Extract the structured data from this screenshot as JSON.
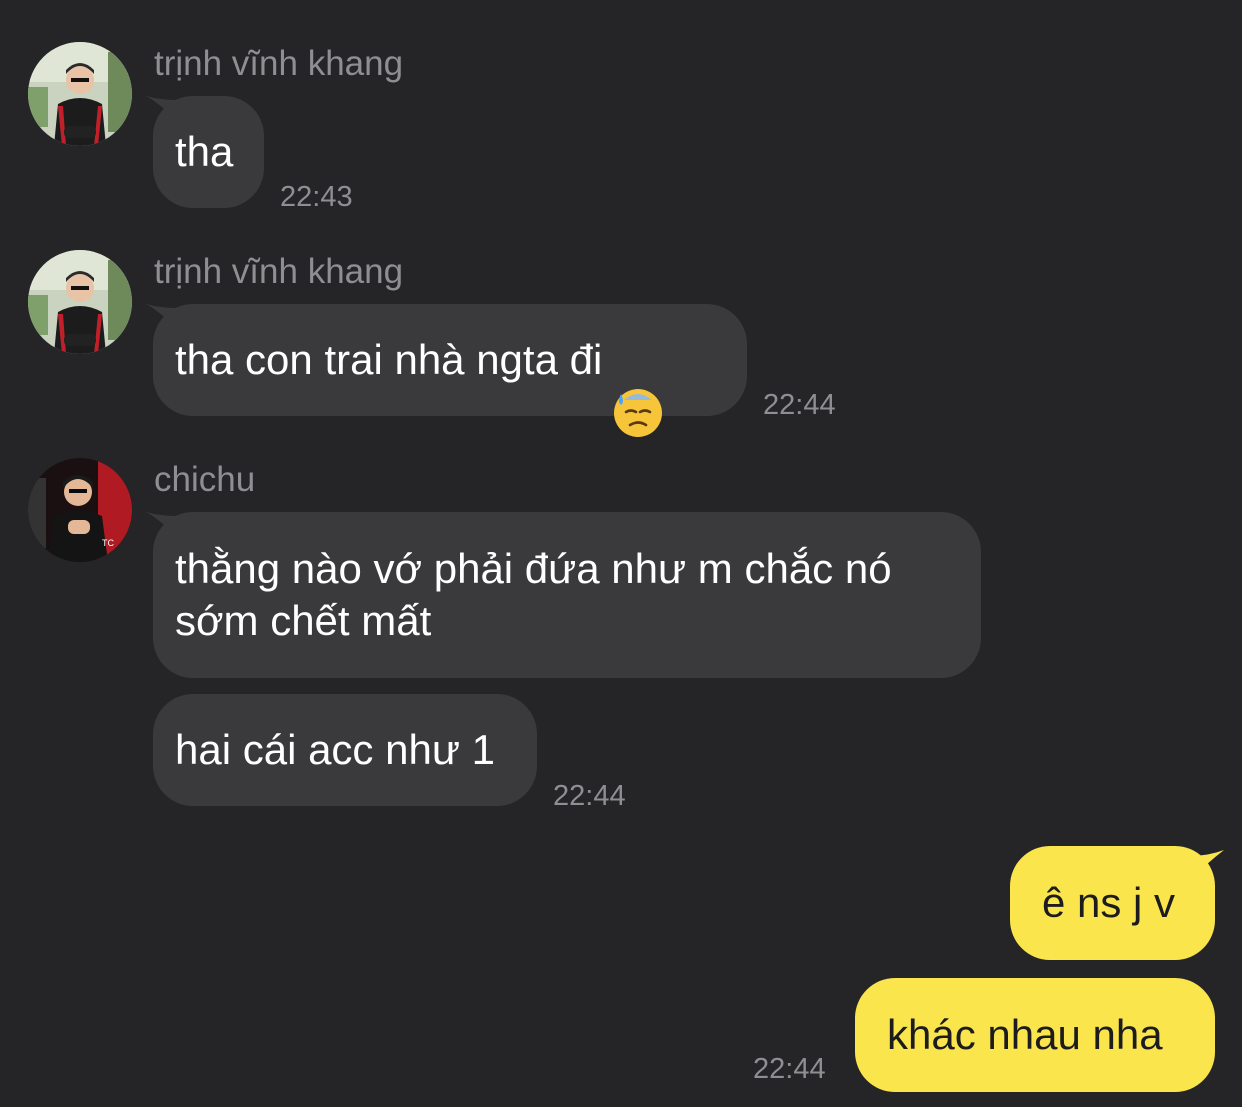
{
  "messages": [
    {
      "sender": "trịnh vĩnh khang",
      "text": "tha",
      "time": "22:43"
    },
    {
      "sender": "trịnh vĩnh khang",
      "text": "tha con trai nhà ngta đi",
      "emoji": "downcast-face-with-sweat-icon",
      "time": "22:44"
    },
    {
      "sender": "chichu",
      "text": "thằng nào vớ phải đứa như m chắc nó\nsớm chết mất"
    },
    {
      "text": "hai cái acc như 1",
      "time": "22:44"
    },
    {
      "text": "ê ns j v"
    },
    {
      "text": "khác nhau nha",
      "time": "22:44"
    }
  ],
  "colors": {
    "background": "#252527",
    "incoming_bubble": "#3a3a3c",
    "outgoing_bubble": "#fbe54c",
    "meta_text": "#8e8e93"
  }
}
